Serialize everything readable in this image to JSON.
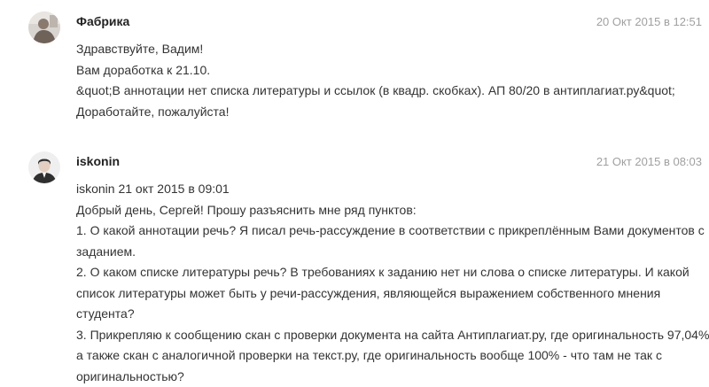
{
  "messages": [
    {
      "author": "Фабрика",
      "timestamp": "20 Окт 2015 в 12:51",
      "avatar_icon": "user-photo-avatar",
      "lines": [
        "Здравствуйте, Вадим!",
        "Вам доработка к 21.10.",
        "&quot;В аннотации нет списка литературы и ссылок (в квадр. скобках). АП 80/20 в антиплагиат.ру&quot;",
        "Доработайте, пожалуйста!"
      ]
    },
    {
      "author": "iskonin",
      "timestamp": "21 Окт 2015 в 08:03",
      "avatar_icon": "user-photo-avatar",
      "lines": [
        "iskonin 21 окт 2015 в 09:01",
        "Добрый день, Сергей! Прошу разъяснить мне ряд пунктов:",
        "1. О какой аннотации речь? Я писал речь-рассуждение в соответствии с прикреплённым Вами документов с",
        "заданием.",
        "2. О каком списке литературы речь? В требованиях к заданию нет ни слова о списке литературы. И какой",
        "список литературы может быть у речи-рассуждения, являющейся выражением собственного мнения",
        "студента?",
        "3. Прикрепляю к сообщению скан с проверки документа на сайта Антиплагиат.ру, где оригинальность 97,04%,",
        "а также скан с аналогичной проверки на текст.ру, где оригинальность вообще 100% - что там не так с",
        "оригинальностью?"
      ]
    }
  ]
}
